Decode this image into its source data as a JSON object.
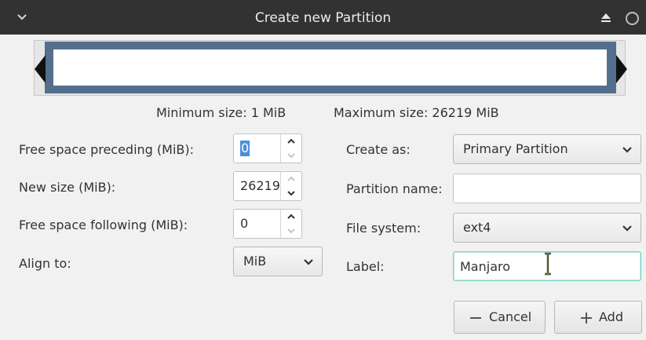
{
  "window": {
    "title": "Create new Partition",
    "icons": {
      "menu": "chevron-down-icon",
      "eject": "eject-icon",
      "close": "circle-icon"
    }
  },
  "size_bar": {
    "min_label": "Minimum size: 1 MiB",
    "max_label": "Maximum size: 26219 MiB"
  },
  "left": {
    "free_preceding": {
      "label": "Free space preceding (MiB):",
      "value": "0"
    },
    "new_size": {
      "label": "New size (MiB):",
      "value": "26219"
    },
    "free_following": {
      "label": "Free space following (MiB):",
      "value": "0"
    },
    "align": {
      "label": "Align to:",
      "value": "MiB"
    }
  },
  "right": {
    "create_as": {
      "label": "Create as:",
      "value": "Primary Partition"
    },
    "partition_name": {
      "label": "Partition name:",
      "value": ""
    },
    "file_system": {
      "label": "File system:",
      "value": "ext4"
    },
    "fs_label": {
      "label": "Label:",
      "value": "Manjaro"
    }
  },
  "buttons": {
    "cancel": "Cancel",
    "add": "Add"
  },
  "colors": {
    "titlebar": "#323232",
    "bar": "#536f8d",
    "selection": "#4a90d9",
    "focus": "#7fd1c2"
  }
}
